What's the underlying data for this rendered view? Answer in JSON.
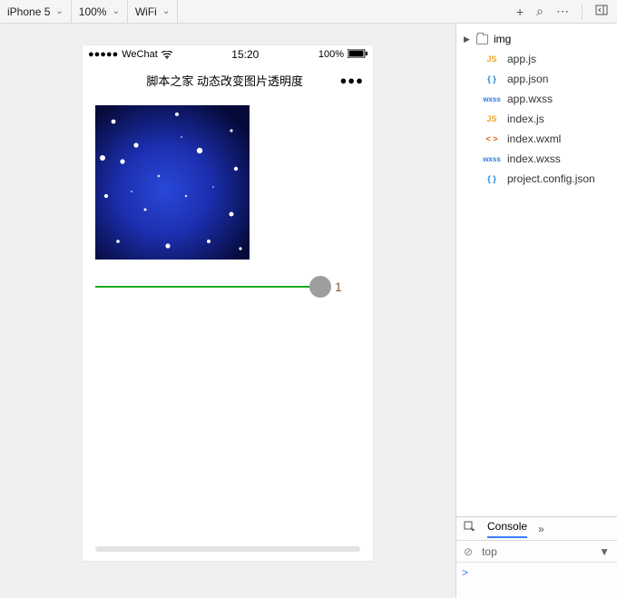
{
  "toolbar": {
    "device": "iPhone 5",
    "zoom": "100%",
    "network": "WiFi",
    "icons": {
      "add": "+",
      "search": "⌕",
      "more": "⋯",
      "panel": "⎘"
    }
  },
  "simulator": {
    "statusbar": {
      "signal": "●●●●●",
      "carrier": "WeChat",
      "time": "15:20",
      "battery": "100%"
    },
    "nav": {
      "title": "脚本之家  动态改变图片透明度",
      "menu": "●●●"
    },
    "slider": {
      "value_label": "1"
    }
  },
  "tree": {
    "folder": "img",
    "files": [
      {
        "badge": "JS",
        "cls": "b-js",
        "name": "app.js"
      },
      {
        "badge": "{ }",
        "cls": "b-json",
        "name": "app.json"
      },
      {
        "badge": "wxss",
        "cls": "b-wxss",
        "name": "app.wxss"
      },
      {
        "badge": "JS",
        "cls": "b-js",
        "name": "index.js"
      },
      {
        "badge": "< >",
        "cls": "b-wxml",
        "name": "index.wxml"
      },
      {
        "badge": "wxss",
        "cls": "b-wxss",
        "name": "index.wxss"
      },
      {
        "badge": "{ }",
        "cls": "b-json",
        "name": "project.config.json"
      }
    ]
  },
  "console": {
    "tab": "Console",
    "context": "top",
    "prompt": ">"
  }
}
